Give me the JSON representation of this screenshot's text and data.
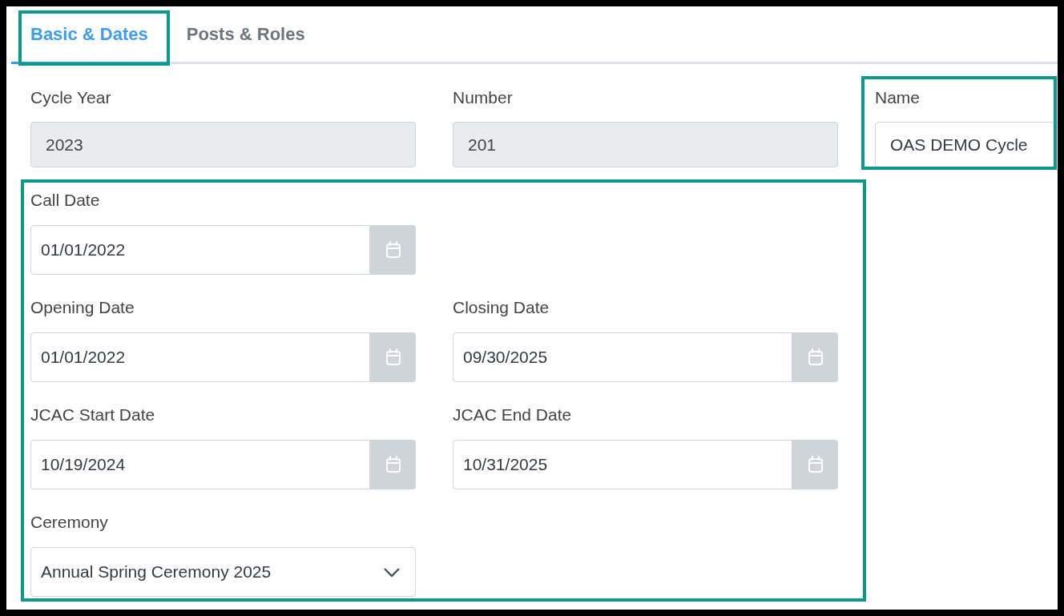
{
  "tabs": [
    {
      "label": "Basic & Dates",
      "selected": true,
      "highlighted": true
    },
    {
      "label": "Posts & Roles",
      "selected": false,
      "highlighted": false
    }
  ],
  "top_row": [
    {
      "label": "Cycle Year",
      "value": "2023",
      "kind": "text",
      "disabled": true,
      "highlighted": false
    },
    {
      "label": "Number",
      "value": "201",
      "kind": "text",
      "disabled": true,
      "highlighted": false
    },
    {
      "label": "Name",
      "value": "OAS DEMO Cycle",
      "kind": "text",
      "disabled": false,
      "highlighted": true
    }
  ],
  "dates_section": {
    "highlighted": true,
    "rows": [
      [
        {
          "label": "Call Date",
          "value": "01/01/2022",
          "kind": "date"
        }
      ],
      [
        {
          "label": "Opening Date",
          "value": "01/01/2022",
          "kind": "date"
        },
        {
          "label": "Closing Date",
          "value": "09/30/2025",
          "kind": "date"
        }
      ],
      [
        {
          "label": "JCAC Start Date",
          "value": "10/19/2024",
          "kind": "date"
        },
        {
          "label": "JCAC End Date",
          "value": "10/31/2025",
          "kind": "date"
        }
      ],
      [
        {
          "label": "Ceremony",
          "value": "Annual Spring Ceremony 2025",
          "kind": "select"
        }
      ]
    ]
  }
}
